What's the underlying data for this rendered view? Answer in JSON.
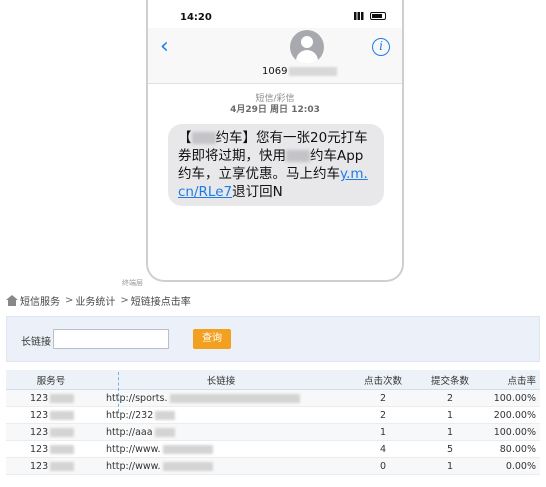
{
  "phone": {
    "status_time": "14:20",
    "contact_number": "1069",
    "sms_meta_type": "短信/彩信",
    "sms_meta_date": "4月29日 周日 12:03",
    "message": {
      "part1": "【",
      "part2": "约车】您有一张20元打车券即将过期，快用",
      "part3": "约车App约车，立享优惠。马上约车",
      "link": "y.m.cn/RLe7",
      "part4": "退订回N"
    },
    "caption": "终端层"
  },
  "panel": {
    "breadcrumb": [
      "短信服务",
      "业务统计",
      "短链接点击率"
    ],
    "breadcrumb_separator": ">",
    "search": {
      "label": "长链接",
      "input_value": "",
      "button_label": "查询"
    },
    "table": {
      "headers": [
        "服务号",
        "长链接",
        "点击次数",
        "提交条数",
        "点击率"
      ],
      "rows": [
        {
          "service": "123",
          "url": "http://sports.",
          "clicks": "2",
          "submits": "2",
          "rate": "100.00%"
        },
        {
          "service": "123",
          "url": "http://232",
          "clicks": "2",
          "submits": "1",
          "rate": "200.00%"
        },
        {
          "service": "123",
          "url": "http://aaa",
          "clicks": "1",
          "submits": "1",
          "rate": "100.00%"
        },
        {
          "service": "123",
          "url": "http://www.",
          "clicks": "4",
          "submits": "5",
          "rate": "80.00%"
        },
        {
          "service": "123",
          "url": "http://www.",
          "clicks": "0",
          "submits": "1",
          "rate": "0.00%"
        }
      ]
    }
  },
  "colors": {
    "ios_blue": "#1e7ce8",
    "search_button": "#f3a021",
    "search_bar_bg": "#ecf1f9"
  }
}
